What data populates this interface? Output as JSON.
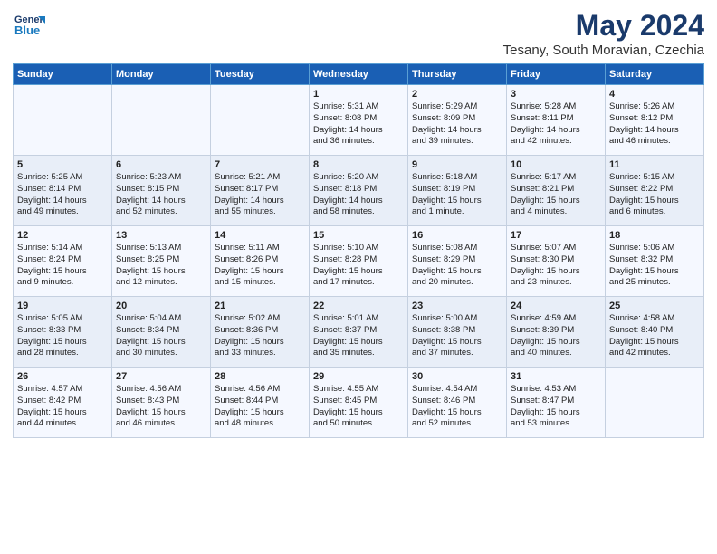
{
  "header": {
    "logo_line1": "General",
    "logo_line2": "Blue",
    "title": "May 2024",
    "subtitle": "Tesany, South Moravian, Czechia"
  },
  "weekdays": [
    "Sunday",
    "Monday",
    "Tuesday",
    "Wednesday",
    "Thursday",
    "Friday",
    "Saturday"
  ],
  "weeks": [
    [
      {
        "day": "",
        "info": ""
      },
      {
        "day": "",
        "info": ""
      },
      {
        "day": "",
        "info": ""
      },
      {
        "day": "1",
        "info": "Sunrise: 5:31 AM\nSunset: 8:08 PM\nDaylight: 14 hours\nand 36 minutes."
      },
      {
        "day": "2",
        "info": "Sunrise: 5:29 AM\nSunset: 8:09 PM\nDaylight: 14 hours\nand 39 minutes."
      },
      {
        "day": "3",
        "info": "Sunrise: 5:28 AM\nSunset: 8:11 PM\nDaylight: 14 hours\nand 42 minutes."
      },
      {
        "day": "4",
        "info": "Sunrise: 5:26 AM\nSunset: 8:12 PM\nDaylight: 14 hours\nand 46 minutes."
      }
    ],
    [
      {
        "day": "5",
        "info": "Sunrise: 5:25 AM\nSunset: 8:14 PM\nDaylight: 14 hours\nand 49 minutes."
      },
      {
        "day": "6",
        "info": "Sunrise: 5:23 AM\nSunset: 8:15 PM\nDaylight: 14 hours\nand 52 minutes."
      },
      {
        "day": "7",
        "info": "Sunrise: 5:21 AM\nSunset: 8:17 PM\nDaylight: 14 hours\nand 55 minutes."
      },
      {
        "day": "8",
        "info": "Sunrise: 5:20 AM\nSunset: 8:18 PM\nDaylight: 14 hours\nand 58 minutes."
      },
      {
        "day": "9",
        "info": "Sunrise: 5:18 AM\nSunset: 8:19 PM\nDaylight: 15 hours\nand 1 minute."
      },
      {
        "day": "10",
        "info": "Sunrise: 5:17 AM\nSunset: 8:21 PM\nDaylight: 15 hours\nand 4 minutes."
      },
      {
        "day": "11",
        "info": "Sunrise: 5:15 AM\nSunset: 8:22 PM\nDaylight: 15 hours\nand 6 minutes."
      }
    ],
    [
      {
        "day": "12",
        "info": "Sunrise: 5:14 AM\nSunset: 8:24 PM\nDaylight: 15 hours\nand 9 minutes."
      },
      {
        "day": "13",
        "info": "Sunrise: 5:13 AM\nSunset: 8:25 PM\nDaylight: 15 hours\nand 12 minutes."
      },
      {
        "day": "14",
        "info": "Sunrise: 5:11 AM\nSunset: 8:26 PM\nDaylight: 15 hours\nand 15 minutes."
      },
      {
        "day": "15",
        "info": "Sunrise: 5:10 AM\nSunset: 8:28 PM\nDaylight: 15 hours\nand 17 minutes."
      },
      {
        "day": "16",
        "info": "Sunrise: 5:08 AM\nSunset: 8:29 PM\nDaylight: 15 hours\nand 20 minutes."
      },
      {
        "day": "17",
        "info": "Sunrise: 5:07 AM\nSunset: 8:30 PM\nDaylight: 15 hours\nand 23 minutes."
      },
      {
        "day": "18",
        "info": "Sunrise: 5:06 AM\nSunset: 8:32 PM\nDaylight: 15 hours\nand 25 minutes."
      }
    ],
    [
      {
        "day": "19",
        "info": "Sunrise: 5:05 AM\nSunset: 8:33 PM\nDaylight: 15 hours\nand 28 minutes."
      },
      {
        "day": "20",
        "info": "Sunrise: 5:04 AM\nSunset: 8:34 PM\nDaylight: 15 hours\nand 30 minutes."
      },
      {
        "day": "21",
        "info": "Sunrise: 5:02 AM\nSunset: 8:36 PM\nDaylight: 15 hours\nand 33 minutes."
      },
      {
        "day": "22",
        "info": "Sunrise: 5:01 AM\nSunset: 8:37 PM\nDaylight: 15 hours\nand 35 minutes."
      },
      {
        "day": "23",
        "info": "Sunrise: 5:00 AM\nSunset: 8:38 PM\nDaylight: 15 hours\nand 37 minutes."
      },
      {
        "day": "24",
        "info": "Sunrise: 4:59 AM\nSunset: 8:39 PM\nDaylight: 15 hours\nand 40 minutes."
      },
      {
        "day": "25",
        "info": "Sunrise: 4:58 AM\nSunset: 8:40 PM\nDaylight: 15 hours\nand 42 minutes."
      }
    ],
    [
      {
        "day": "26",
        "info": "Sunrise: 4:57 AM\nSunset: 8:42 PM\nDaylight: 15 hours\nand 44 minutes."
      },
      {
        "day": "27",
        "info": "Sunrise: 4:56 AM\nSunset: 8:43 PM\nDaylight: 15 hours\nand 46 minutes."
      },
      {
        "day": "28",
        "info": "Sunrise: 4:56 AM\nSunset: 8:44 PM\nDaylight: 15 hours\nand 48 minutes."
      },
      {
        "day": "29",
        "info": "Sunrise: 4:55 AM\nSunset: 8:45 PM\nDaylight: 15 hours\nand 50 minutes."
      },
      {
        "day": "30",
        "info": "Sunrise: 4:54 AM\nSunset: 8:46 PM\nDaylight: 15 hours\nand 52 minutes."
      },
      {
        "day": "31",
        "info": "Sunrise: 4:53 AM\nSunset: 8:47 PM\nDaylight: 15 hours\nand 53 minutes."
      },
      {
        "day": "",
        "info": ""
      }
    ]
  ]
}
